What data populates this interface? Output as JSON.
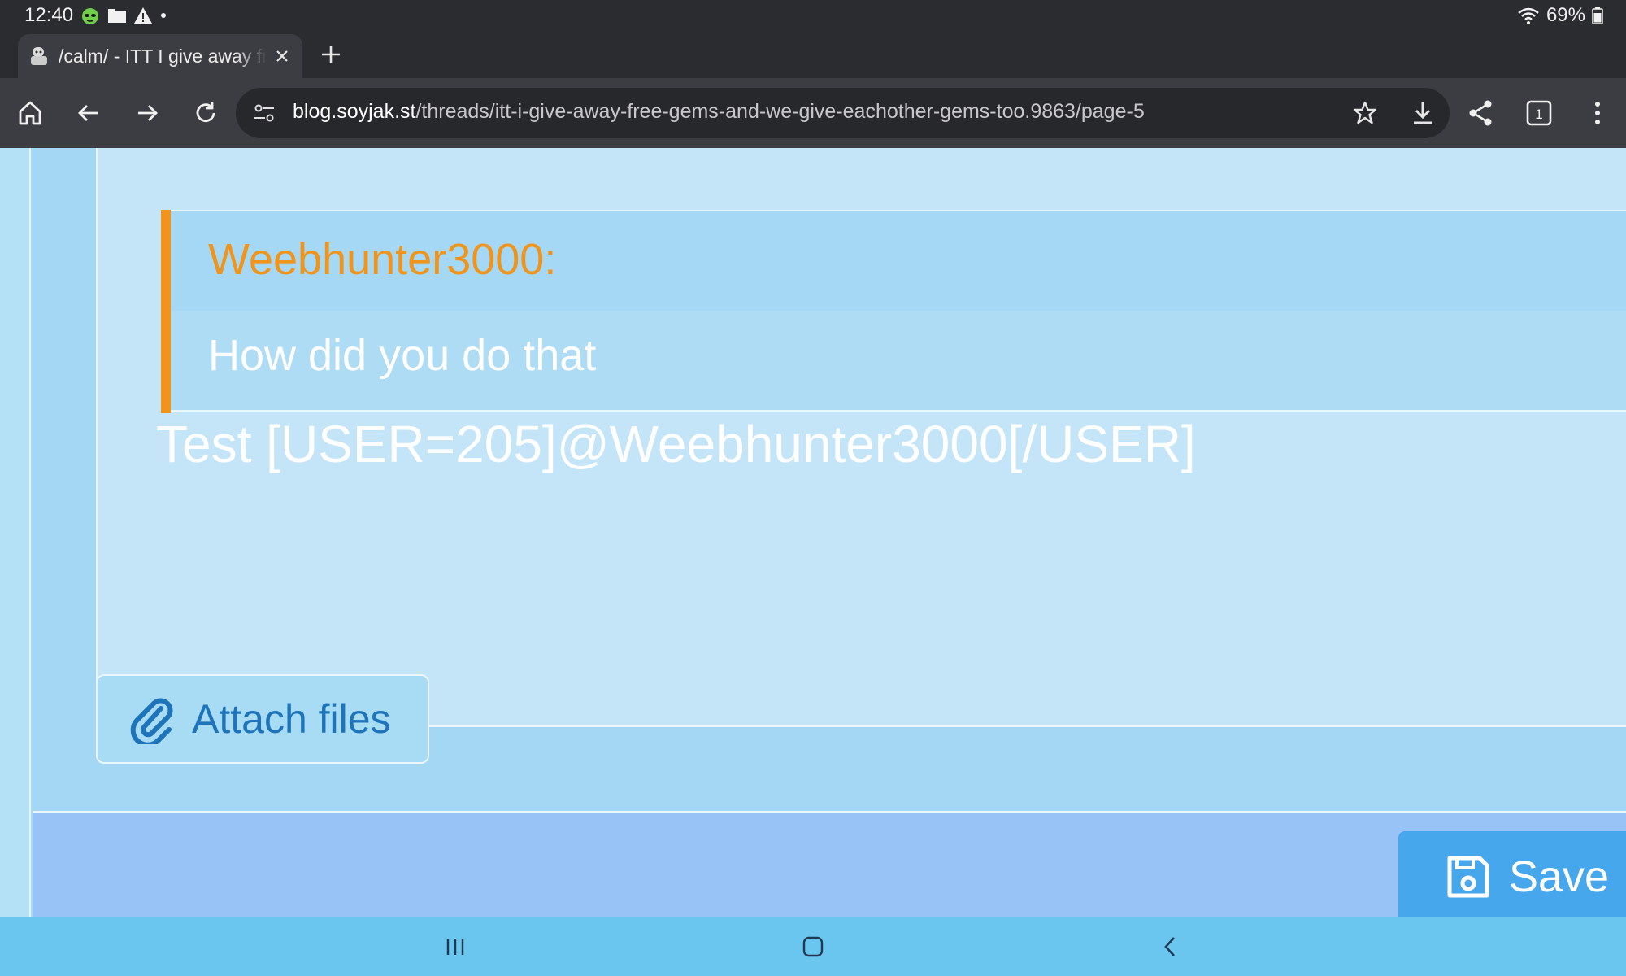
{
  "status_bar": {
    "time": "12:40",
    "battery": "69%",
    "icons": [
      "alien-icon",
      "folder-icon",
      "warning-icon",
      "dot-icon",
      "wifi-icon",
      "battery-icon"
    ]
  },
  "browser": {
    "tab": {
      "title": "/calm/ - ITT I give away free gems",
      "favicon": "soyjak-favicon-icon"
    },
    "url_host": "blog.soyjak.st",
    "url_path": "/threads/itt-i-give-away-free-gems-and-we-give-eachother-gems-too.9863/page-5",
    "tab_count": "1",
    "colors": {
      "chrome_dark": "#2b2c30",
      "chrome_mid": "#3c3d42",
      "omnibox": "#27282c"
    }
  },
  "editor": {
    "quote": {
      "author": "Weebhunter3000:",
      "text": "How did you do that"
    },
    "message": "Test [USER=205]@Weebhunter3000[/USER]"
  },
  "actions": {
    "attach_label": "Attach files",
    "save_label": "Save"
  },
  "theme": {
    "page_bg": "#a8dbf3",
    "editor_bg": "#c4e5f8",
    "quote_accent": "#f0941c",
    "link_blue": "#1e74ba",
    "save_bg": "#46a7ec",
    "footer_bg": "#98c3f7",
    "navbar_bg": "#6ac5ef"
  },
  "navbar": {
    "buttons": [
      "recents-icon",
      "home-icon",
      "back-icon"
    ]
  }
}
